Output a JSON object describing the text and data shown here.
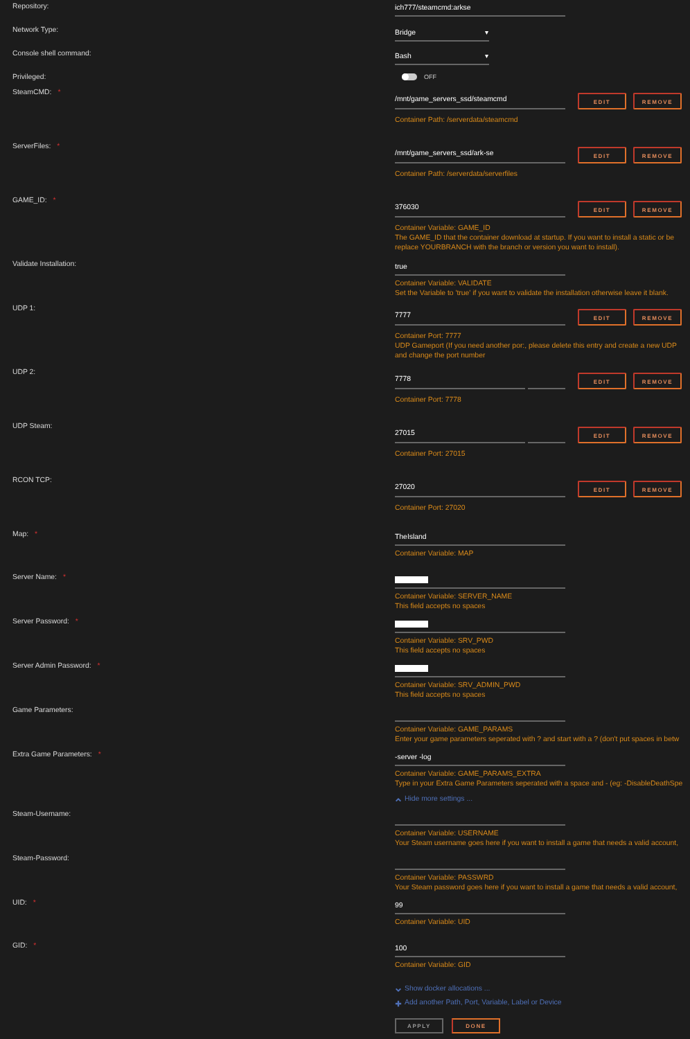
{
  "settings": [
    {
      "kind": "text",
      "label": "Repository:",
      "value": "ich777/steamcmd:arkse"
    },
    {
      "kind": "select",
      "label": "Network Type:",
      "value": "Bridge",
      "caret": "▾"
    },
    {
      "kind": "select",
      "label": "Console shell command:",
      "value": "Bash",
      "caret": "▾"
    },
    {
      "kind": "toggle",
      "label": "Privileged:",
      "on": false,
      "state_text": "OFF"
    },
    {
      "kind": "mapping",
      "label": "SteamCMD:",
      "required_mark": "*",
      "value": "/mnt/game_servers_ssd/steamcmd",
      "split": false,
      "buttons": [
        "EDIT",
        "REMOVE"
      ],
      "descriptions": [
        "Container Path: /serverdata/steamcmd"
      ]
    },
    {
      "kind": "mapping",
      "label": "ServerFiles:",
      "required_mark": "*",
      "value": "/mnt/game_servers_ssd/ark-se",
      "split": false,
      "buttons": [
        "EDIT",
        "REMOVE"
      ],
      "descriptions": [
        "Container Path: /serverdata/serverfiles"
      ]
    },
    {
      "kind": "mapping",
      "label": "GAME_ID:",
      "required_mark": "*",
      "value": "376030",
      "split": false,
      "buttons": [
        "EDIT",
        "REMOVE"
      ],
      "descriptions": [
        "Container Variable: GAME_ID",
        "The GAME_ID that the container download at startup. If you want to install a static or be",
        "replace YOURBRANCH with the branch or version you want to install)."
      ]
    },
    {
      "kind": "variable",
      "label": "Validate Installation:",
      "value": "true",
      "masked": false,
      "descriptions": [
        "Container Variable: VALIDATE",
        "Set the Variable to 'true' if you want to validate the installation otherwise leave it blank."
      ]
    },
    {
      "kind": "mapping",
      "label": "UDP 1:",
      "value": "7777",
      "split": false,
      "buttons": [
        "EDIT",
        "REMOVE"
      ],
      "descriptions": [
        "Container Port: 7777",
        "UDP Gameport (If you need another por:, please delete this entry and create a new UDP",
        "and change the port number"
      ]
    },
    {
      "kind": "mapping",
      "label": "UDP 2:",
      "value": "7778",
      "split": true,
      "buttons": [
        "EDIT",
        "REMOVE"
      ],
      "descriptions": [
        "Container Port: 7778"
      ]
    },
    {
      "kind": "mapping",
      "label": "UDP Steam:",
      "value": "27015",
      "split": true,
      "buttons": [
        "EDIT",
        "REMOVE"
      ],
      "descriptions": [
        "Container Port: 27015"
      ]
    },
    {
      "kind": "mapping",
      "label": "RCON TCP:",
      "value": "27020",
      "split": false,
      "buttons": [
        "EDIT",
        "REMOVE"
      ],
      "descriptions": [
        "Container Port: 27020"
      ]
    },
    {
      "kind": "variable",
      "label": "Map:",
      "required_mark": "*",
      "value": "TheIsland",
      "masked": false,
      "descriptions": [
        "Container Variable: MAP"
      ]
    },
    {
      "kind": "variable",
      "label": "Server Name:",
      "required_mark": "*",
      "masked": true,
      "descriptions": [
        "Container Variable: SERVER_NAME",
        "This field accepts no spaces"
      ]
    },
    {
      "kind": "variable",
      "label": "Server Password:",
      "required_mark": "*",
      "masked": true,
      "descriptions": [
        "Container Variable: SRV_PWD",
        "This field accepts no spaces"
      ]
    },
    {
      "kind": "variable",
      "label": "Server Admin Password:",
      "required_mark": "*",
      "masked": true,
      "descriptions": [
        "Container Variable: SRV_ADMIN_PWD",
        "This field accepts no spaces"
      ]
    },
    {
      "kind": "variable",
      "label": "Game Parameters:",
      "masked": false,
      "descriptions": [
        "Container Variable: GAME_PARAMS",
        "Enter your game parameters seperated with ? and start with a ? (don't put spaces in betw"
      ]
    },
    {
      "kind": "variable",
      "label": "Extra Game Parameters:",
      "required_mark": "*",
      "value": "-server -log",
      "masked": false,
      "descriptions": [
        "Container Variable: GAME_PARAMS_EXTRA",
        "Type in your Extra Game Parameters seperated with a space and - (eg: -DisableDeathSpe"
      ]
    },
    {
      "kind": "link",
      "label": "Hide more settings ...",
      "expanded": true
    },
    {
      "kind": "variable",
      "label": "Steam-Username:",
      "masked": false,
      "descriptions": [
        "Container Variable: USERNAME",
        "Your Steam username goes here if you want to install a game that needs a valid account,"
      ]
    },
    {
      "kind": "variable",
      "label": "Steam-Password:",
      "masked": false,
      "descriptions": [
        "Container Variable: PASSWRD",
        "Your Steam password goes here if you want to install a game that needs a valid account,"
      ]
    },
    {
      "kind": "variable",
      "label": "UID:",
      "required_mark": "*",
      "value": "99",
      "masked": false,
      "descriptions": [
        "Container Variable: UID"
      ]
    },
    {
      "kind": "variable",
      "label": "GID:",
      "required_mark": "*",
      "value": "100",
      "masked": false,
      "descriptions": [
        "Container Variable: GID"
      ]
    },
    {
      "kind": "link",
      "label": "Show docker allocations ...",
      "expanded": false
    },
    {
      "kind": "add",
      "label": "Add another Path, Port, Variable, Label or Device"
    }
  ],
  "actions": [
    {
      "label": "APPLY",
      "disabled": true
    },
    {
      "label": "DONE",
      "disabled": false
    }
  ]
}
